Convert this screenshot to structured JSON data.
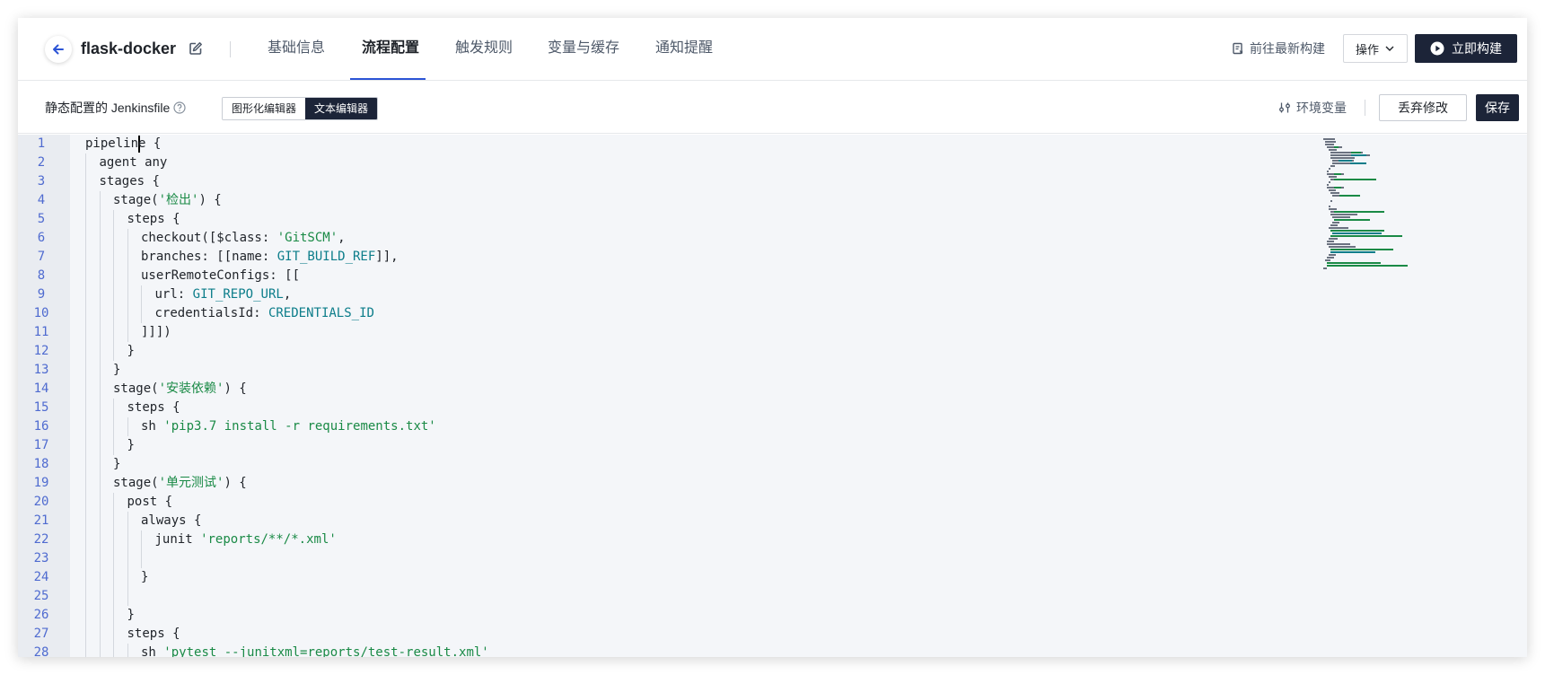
{
  "header": {
    "project_name": "flask-docker",
    "tabs": [
      {
        "label": "基础信息",
        "active": false
      },
      {
        "label": "流程配置",
        "active": true
      },
      {
        "label": "触发规则",
        "active": false
      },
      {
        "label": "变量与缓存",
        "active": false
      },
      {
        "label": "通知提醒",
        "active": false
      }
    ],
    "goto_latest": "前往最新构建",
    "ops_label": "操作",
    "build_label": "立即构建"
  },
  "toolbar": {
    "label": "静态配置的 Jenkinsfile",
    "seg_graphic": "图形化编辑器",
    "seg_text": "文本编辑器",
    "env_var": "环境变量",
    "discard": "丢弃修改",
    "save": "保存"
  },
  "colors": {
    "accent": "#2c54d6",
    "dark_button": "#1c2438",
    "string": "#1a8a46",
    "variable": "#0c7d8a",
    "line_number": "#4f6bd0"
  },
  "editor": {
    "lines": [
      {
        "n": "1",
        "indent": 0,
        "parts": [
          [
            "t",
            "pipeline {"
          ]
        ]
      },
      {
        "n": "2",
        "indent": 1,
        "parts": [
          [
            "t",
            "agent any"
          ]
        ]
      },
      {
        "n": "3",
        "indent": 1,
        "parts": [
          [
            "t",
            "stages {"
          ]
        ]
      },
      {
        "n": "4",
        "indent": 2,
        "parts": [
          [
            "t",
            "stage("
          ],
          [
            "s",
            "'检出'"
          ],
          [
            "t",
            ") {"
          ]
        ]
      },
      {
        "n": "5",
        "indent": 3,
        "parts": [
          [
            "t",
            "steps {"
          ]
        ]
      },
      {
        "n": "6",
        "indent": 4,
        "parts": [
          [
            "t",
            "checkout([$class: "
          ],
          [
            "s",
            "'GitSCM'"
          ],
          [
            "t",
            ","
          ]
        ]
      },
      {
        "n": "7",
        "indent": 4,
        "parts": [
          [
            "t",
            "branches: [[name: "
          ],
          [
            "v",
            "GIT_BUILD_REF"
          ],
          [
            "t",
            "]],"
          ]
        ]
      },
      {
        "n": "8",
        "indent": 4,
        "parts": [
          [
            "t",
            "userRemoteConfigs: [["
          ]
        ]
      },
      {
        "n": "9",
        "indent": 5,
        "parts": [
          [
            "t",
            "url: "
          ],
          [
            "v",
            "GIT_REPO_URL"
          ],
          [
            "t",
            ","
          ]
        ]
      },
      {
        "n": "10",
        "indent": 5,
        "parts": [
          [
            "t",
            "credentialsId: "
          ],
          [
            "v",
            "CREDENTIALS_ID"
          ]
        ]
      },
      {
        "n": "11",
        "indent": 4,
        "parts": [
          [
            "t",
            "]]])"
          ]
        ]
      },
      {
        "n": "12",
        "indent": 3,
        "parts": [
          [
            "t",
            "}"
          ]
        ]
      },
      {
        "n": "13",
        "indent": 2,
        "parts": [
          [
            "t",
            "}"
          ]
        ]
      },
      {
        "n": "14",
        "indent": 2,
        "parts": [
          [
            "t",
            "stage("
          ],
          [
            "s",
            "'安装依赖'"
          ],
          [
            "t",
            ") {"
          ]
        ]
      },
      {
        "n": "15",
        "indent": 3,
        "parts": [
          [
            "t",
            "steps {"
          ]
        ]
      },
      {
        "n": "16",
        "indent": 4,
        "parts": [
          [
            "t",
            "sh "
          ],
          [
            "s",
            "'pip3.7 install -r requirements.txt'"
          ]
        ]
      },
      {
        "n": "17",
        "indent": 3,
        "parts": [
          [
            "t",
            "}"
          ]
        ]
      },
      {
        "n": "18",
        "indent": 2,
        "parts": [
          [
            "t",
            "}"
          ]
        ]
      },
      {
        "n": "19",
        "indent": 2,
        "parts": [
          [
            "t",
            "stage("
          ],
          [
            "s",
            "'单元测试'"
          ],
          [
            "t",
            ") {"
          ]
        ]
      },
      {
        "n": "20",
        "indent": 3,
        "parts": [
          [
            "t",
            "post {"
          ]
        ]
      },
      {
        "n": "21",
        "indent": 4,
        "parts": [
          [
            "t",
            "always {"
          ]
        ]
      },
      {
        "n": "22",
        "indent": 5,
        "parts": [
          [
            "t",
            "junit "
          ],
          [
            "s",
            "'reports/**/*.xml'"
          ]
        ]
      },
      {
        "n": "23",
        "indent": 5,
        "parts": []
      },
      {
        "n": "24",
        "indent": 4,
        "parts": [
          [
            "t",
            "}"
          ]
        ]
      },
      {
        "n": "25",
        "indent": 4,
        "parts": []
      },
      {
        "n": "26",
        "indent": 3,
        "parts": [
          [
            "t",
            "}"
          ]
        ]
      },
      {
        "n": "27",
        "indent": 3,
        "parts": [
          [
            "t",
            "steps {"
          ]
        ]
      },
      {
        "n": "28",
        "indent": 4,
        "parts": [
          [
            "t",
            "sh "
          ],
          [
            "s",
            "'pytest --junitxml=reports/test-result.xml'"
          ]
        ]
      }
    ]
  }
}
